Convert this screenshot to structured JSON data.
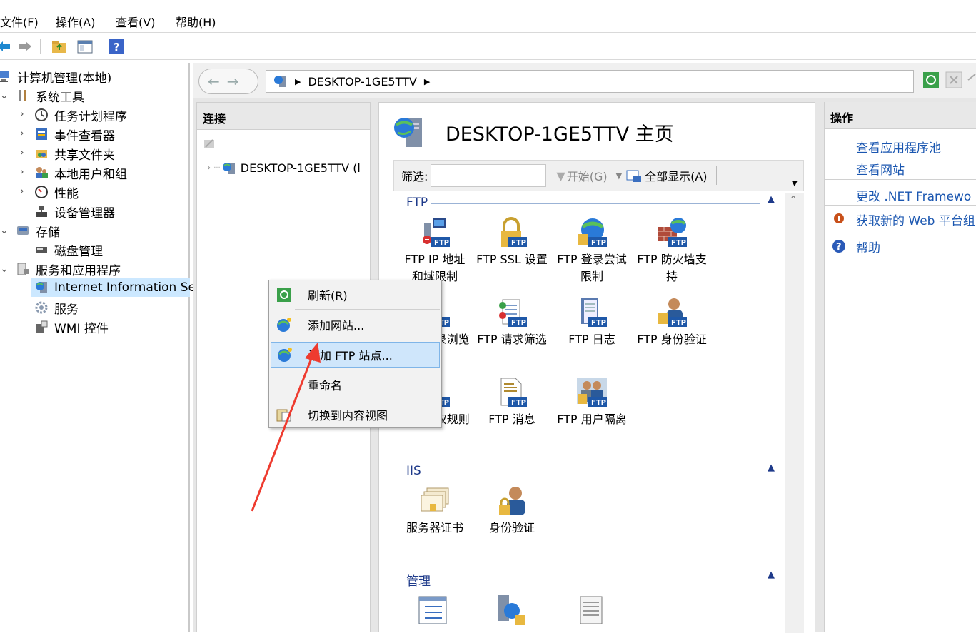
{
  "menubar": {
    "file": "文件(F)",
    "action": "操作(A)",
    "view": "查看(V)",
    "help": "帮助(H)"
  },
  "tree": {
    "root": "计算机管理(本地)",
    "system_tools": "系统工具",
    "task_scheduler": "任务计划程序",
    "event_viewer": "事件查看器",
    "shared_folders": "共享文件夹",
    "local_users": "本地用户和组",
    "performance": "性能",
    "device_manager": "设备管理器",
    "storage": "存储",
    "disk_mgmt": "磁盘管理",
    "services_apps": "服务和应用程序",
    "iis": "Internet Information Se",
    "services": "服务",
    "wmi": "WMI 控件"
  },
  "address": {
    "server": "DESKTOP-1GE5TTV"
  },
  "connections": {
    "header": "连接",
    "server": "DESKTOP-1GE5TTV (l"
  },
  "center": {
    "title": "DESKTOP-1GE5TTV 主页",
    "filter_label": "筛选:",
    "start_label": "开始(G)",
    "showall_label": "全部显示(A)",
    "groups": {
      "ftp": "FTP",
      "iis": "IIS",
      "manage": "管理"
    },
    "features": {
      "ftp_ip": "FTP IP 地址\n和域限制",
      "ftp_ssl": "FTP SSL 设置",
      "ftp_logon": "FTP 登录尝试\n限制",
      "ftp_firewall": "FTP 防火墙支\n持",
      "ftp_dir": "FTP 目录浏览",
      "ftp_request": "FTP 请求筛选",
      "ftp_log": "FTP 日志",
      "ftp_auth": "FTP 身份验证",
      "ftp_authz": "FTP 授权规则",
      "ftp_msg": "FTP 消息",
      "ftp_isolation": "FTP 用户隔离",
      "server_cert": "服务器证书",
      "auth": "身份验证"
    }
  },
  "actions": {
    "header": "操作",
    "view_pools": "查看应用程序池",
    "view_sites": "查看网站",
    "change_net": "更改 .NET Framewo",
    "get_web": "获取新的 Web 平台组",
    "help": "帮助"
  },
  "context_menu": {
    "refresh": "刷新(R)",
    "add_site": "添加网站...",
    "add_ftp": "添加 FTP 站点...",
    "rename": "重命名",
    "switch_view": "切换到内容视图"
  },
  "colors": {
    "accent": "#1a56b0",
    "selection": "#cce8ff",
    "arrow": "#ee3b2f"
  }
}
